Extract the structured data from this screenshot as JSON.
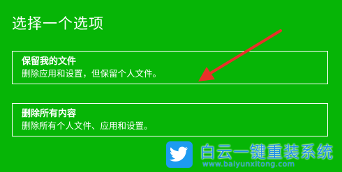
{
  "page": {
    "title": "选择一个选项"
  },
  "options": [
    {
      "title": "保留我的文件",
      "description": "删除应用和设置，但保留个人文件。"
    },
    {
      "title": "删除所有内容",
      "description": "删除所有个人文件、应用和设置。"
    }
  ],
  "watermark": {
    "icon": "bird-logo-icon",
    "name": "白云一键重装系统",
    "url": "www.baiyunxitong.com"
  },
  "colors": {
    "background": "#06b506",
    "text": "#ffffff",
    "arrow": "#e8312a",
    "watermark": "#1d8fe8"
  }
}
